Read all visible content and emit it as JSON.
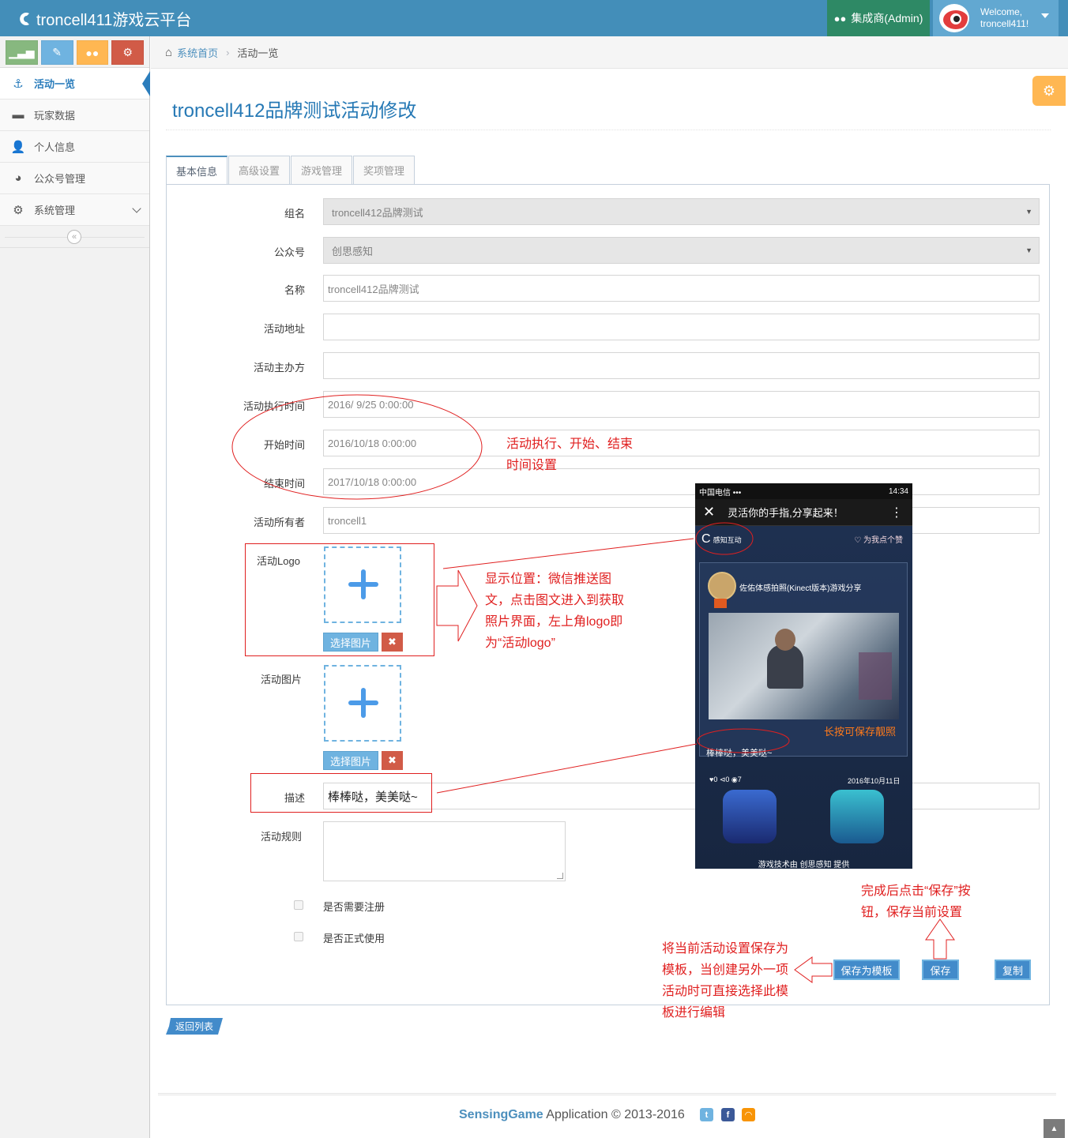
{
  "navbar": {
    "brand": "troncell411游戏云平台",
    "role": "集成商(Admin)",
    "welcome": "Welcome,",
    "username": "troncell411!"
  },
  "sidebar": {
    "shortcut_colors": [
      "#87b87f",
      "#6fb3e0",
      "#ffb752",
      "#d15b47"
    ],
    "items": [
      {
        "label": "活动一览",
        "icon": "anchor-icon",
        "active": true
      },
      {
        "label": "玩家数据",
        "icon": "archive-icon"
      },
      {
        "label": "个人信息",
        "icon": "user-icon"
      },
      {
        "label": "公众号管理",
        "icon": "wechat-icon"
      },
      {
        "label": "系统管理",
        "icon": "gears-icon"
      }
    ]
  },
  "breadcrumb": {
    "home": "系统首页",
    "current": "活动一览"
  },
  "page_title": "troncell412品牌测试活动修改",
  "tabs": [
    "基本信息",
    "高级设置",
    "游戏管理",
    "奖项管理"
  ],
  "form": {
    "group_label": "组名",
    "group_value": "troncell412品牌测试",
    "account_label": "公众号",
    "account_value": "创思感知",
    "name_label": "名称",
    "name_value": "troncell412品牌测试",
    "address_label": "活动地址",
    "address_value": "",
    "organizer_label": "活动主办方",
    "organizer_value": "",
    "exec_time_label": "活动执行时间",
    "exec_time_value": "2016/ 9/25 0:00:00",
    "start_label": "开始时间",
    "start_value": "2016/10/18 0:00:00",
    "end_label": "结束时间",
    "end_value": "2017/10/18 0:00:00",
    "owner_label": "活动所有者",
    "owner_value": "troncell1",
    "logo_label": "活动Logo",
    "image_label": "活动图片",
    "pick_image": "选择图片",
    "delete_icon": "✖",
    "desc_label": "描述",
    "desc_value": "棒棒哒，美美哒~",
    "rules_label": "活动规则",
    "register_label": "是否需要注册",
    "official_label": "是否正式使用"
  },
  "buttons": {
    "save_template": "保存为模板",
    "save": "保存",
    "copy": "复制",
    "back": "返回列表"
  },
  "annotations": {
    "time_note": [
      "活动执行、开始、结束",
      "时间设置"
    ],
    "logo_note": [
      "显示位置：微信推送图",
      "文，点击图文进入到获取",
      "照片界面，左上角logo即",
      "为“活动logo”"
    ],
    "save_note": [
      "完成后点击“保存”按",
      "钮，保存当前设置"
    ],
    "template_note": [
      "将当前活动设置保存为",
      "模板，当创建另外一项",
      "活动时可直接选择此模",
      "板进行编辑"
    ]
  },
  "phone": {
    "carrier": "中国电信 •••",
    "time": "14:34",
    "title": "灵活你的手指,分享起来！",
    "logo_text": "感知互动",
    "like_text": "♡ 为我点个赞",
    "card_title": "佐佑体感拍照(Kinect版本)游戏分享",
    "save_hint": "长按可保存靓照",
    "desc": "棒棒哒，美美哒~",
    "stats": "♥0 ⊲0 ◉7",
    "date": "2016年10月11日",
    "footer": "游戏技术由 创思感知 提供"
  },
  "footer": {
    "brand": "SensingGame",
    "text": " Application © 2013-2016"
  }
}
